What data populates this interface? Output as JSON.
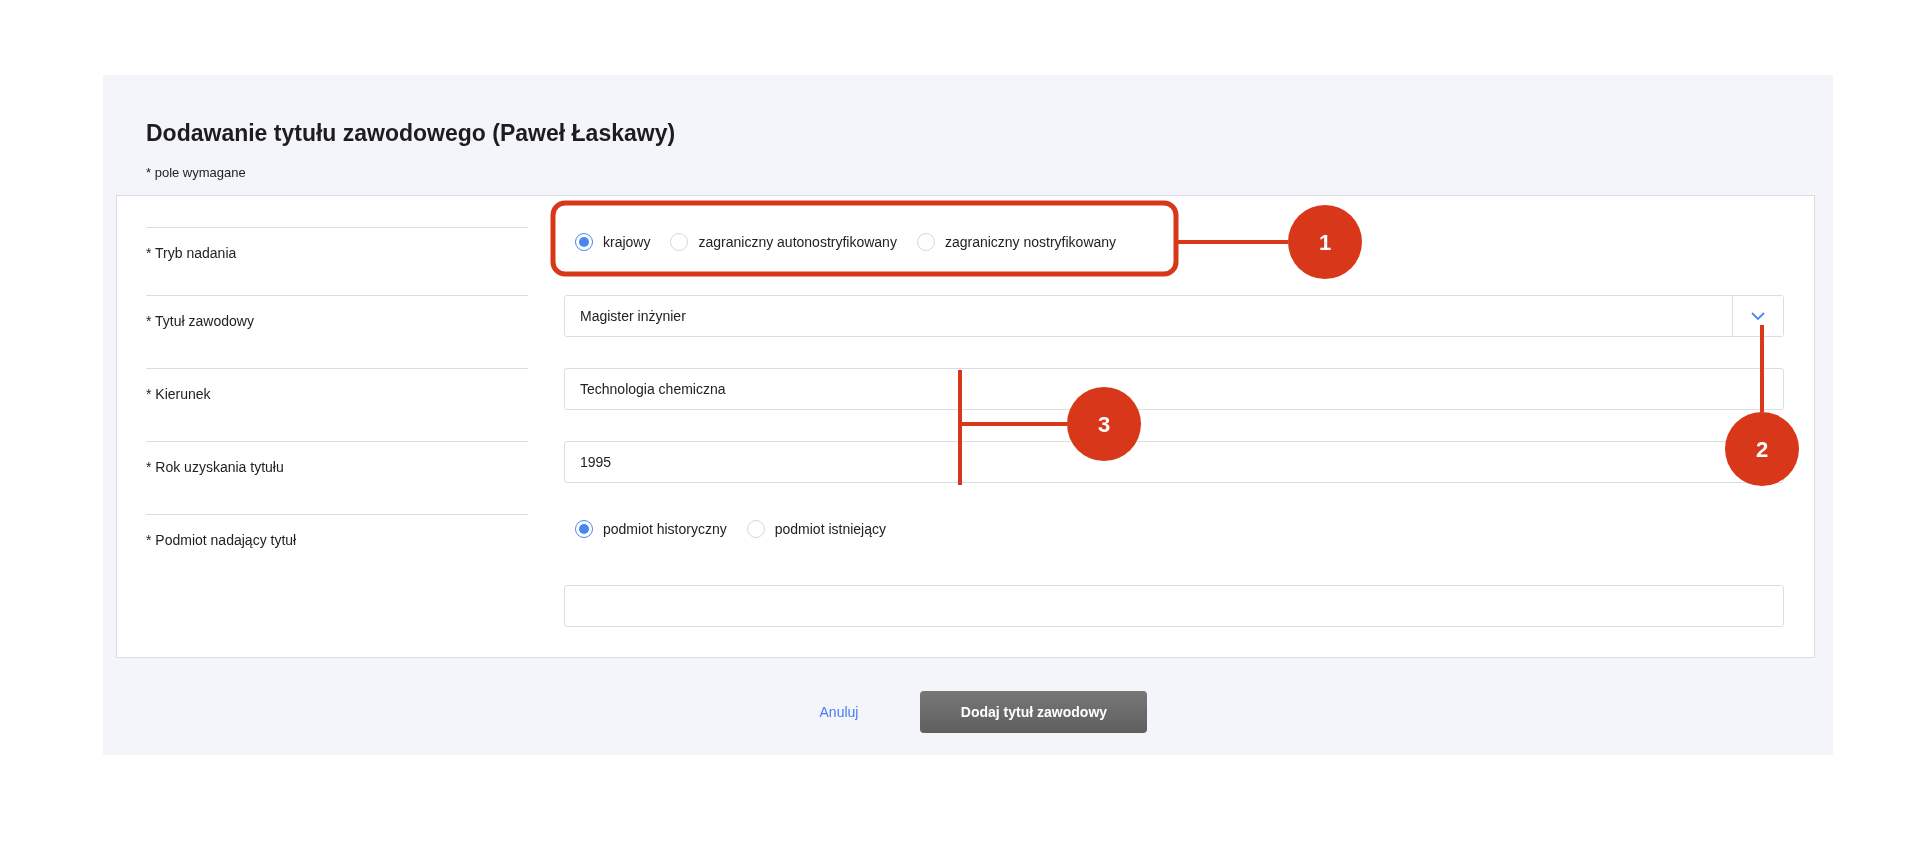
{
  "title": "Dodawanie tytułu zawodowego (Paweł Łaskawy)",
  "required_note": "* pole wymagane",
  "fields": [
    {
      "kind": "radio",
      "label": "* Tryb nadania",
      "options": [
        {
          "label": "krajowy",
          "selected": true
        },
        {
          "label": "zagraniczny autonostryfikowany",
          "selected": false
        },
        {
          "label": "zagraniczny nostryfikowany",
          "selected": false
        }
      ]
    },
    {
      "kind": "select",
      "label": "* Tytuł zawodowy",
      "value": "Magister inżynier"
    },
    {
      "kind": "text",
      "label": "* Kierunek",
      "value": "Technologia chemiczna"
    },
    {
      "kind": "text",
      "label": "* Rok uzyskania tytułu",
      "value": "1995"
    },
    {
      "kind": "radio_text",
      "label": "* Podmiot nadający tytuł",
      "options": [
        {
          "label": "podmiot historyczny",
          "selected": true
        },
        {
          "label": "podmiot istniejący",
          "selected": false
        }
      ]
    }
  ],
  "buttons": {
    "cancel": "Anuluj",
    "submit": "Dodaj tytuł zawodowy"
  },
  "annotations": [
    {
      "label": "1"
    },
    {
      "label": "2"
    },
    {
      "label": "3"
    }
  ]
}
